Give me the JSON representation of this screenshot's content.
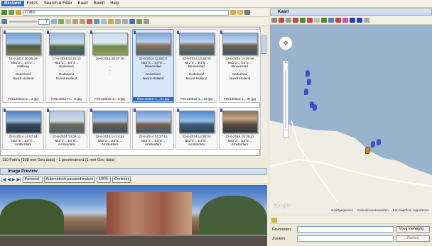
{
  "menu": [
    "Bestand",
    "Foto's",
    "Search & Filter",
    "Kaart",
    "Beeld",
    "Help"
  ],
  "path": "C:\\BD",
  "zoom_spinner": "7",
  "thumbnails": [
    {
      "date": "14-6-2014 20:15:39",
      "coords": "N52°2'...  E4°4'...",
      "city": "Halfweg",
      "country": "Nederland",
      "region": "Noord-Holland",
      "file": "P20140614-2....3.jpg",
      "stars": "☆☆☆☆☆",
      "selected": false,
      "bg": "linear-gradient(#6d9fd8 0%,#a9c8ea 45%,#4d5b3a 60%,#7c7966 100%)"
    },
    {
      "date": "17-6-2014 15:30:43",
      "coords": "N52°2'...  E4°4'...",
      "city": "Ouderkerk",
      "country": "Nederland",
      "region": "Noord-Holland",
      "file": "P20140617-1....5.jpg",
      "stars": "☆☆☆☆☆",
      "selected": false,
      "bg": "linear-gradient(#9bbbe4 0%,#c9dbf0 45%,#5a6a3b 62%,#3b5a78 100%)"
    },
    {
      "date": "18-6-2014 20:07:39",
      "coords": "-",
      "city": "-",
      "country": "-",
      "region": "-",
      "file": "P20140618-2....3.jpg",
      "stars": "",
      "selected": false,
      "bg": "linear-gradient(#c7dcef 0%,#dfe9f3 45%,#6f8a44 62%,#8aa15a 100%)"
    },
    {
      "date": "22-6-2014 11:58:07",
      "coords": "N52°2'...  E4°5'...",
      "city": "Binnenstad",
      "country": "Nederland",
      "region": "Noord-Holland",
      "file": "P20140622-1....31.jpg",
      "stars": "☆☆☆☆☆",
      "selected": true,
      "bg": "linear-gradient(#7aa7de 0%,#b5cde9 40%,#8a6e56 58%,#4c6670 100%)"
    },
    {
      "date": "22-6-2014 13:59:30",
      "coords": "N52°2'...  E4°5'...",
      "city": "Binnenstad",
      "country": "Nederland",
      "region": "Noord-Holland",
      "file": "P20140622-1....33.jpg",
      "stars": "☆☆☆☆☆",
      "selected": false,
      "bg": "linear-gradient(#7ea9df 0%,#bcd2ec 40%,#7b6a58 58%,#425d6c 100%)"
    },
    {
      "date": "22-6-2014 14:00:56",
      "coords": "N52°2'...  E4°5'...",
      "city": "Binnenstad",
      "country": "Nederland",
      "region": "Noord-Holland",
      "file": "P20140622-1....37.jpg",
      "stars": "☆☆☆☆☆",
      "selected": false,
      "bg": "linear-gradient(#84acdf 0%,#c3d6ee 40%,#6e5e4c 58%,#3f5766 100%)"
    },
    {
      "date": "22-6-2014 14:07:54",
      "coords": "N52°2'...  E4°5'...",
      "city": "Amsterdam",
      "country": "",
      "region": "",
      "file": "",
      "stars": "",
      "selected": false,
      "bg": "linear-gradient(#4d7fc0 0%,#9dbce0 45%,#3a4a5a 62%,#253545 100%)"
    },
    {
      "date": "22-6-2014 14:09:11",
      "coords": "N52°2'...  E4°5'...",
      "city": "Amsterdam",
      "country": "",
      "region": "",
      "file": "",
      "stars": "",
      "selected": false,
      "bg": "linear-gradient(#b0c6de 0%,#d0dbe6 45%,#6a6a5a 62%,#55606a 100%)"
    },
    {
      "date": "22-6-2014 14:24:31",
      "coords": "N52°2'...  E4°5'...",
      "city": "Amsterdam",
      "country": "",
      "region": "",
      "file": "",
      "stars": "",
      "selected": false,
      "bg": "linear-gradient(#5f8fcf 0%,#a4c1e2 45%,#6a5a48 62%,#3e5262 100%)"
    },
    {
      "date": "22-6-2014 14:27:13",
      "coords": "N52°2'...  E4°5'...",
      "city": "Amsterdam",
      "country": "",
      "region": "",
      "file": "",
      "stars": "",
      "selected": false,
      "bg": "linear-gradient(#6f9ad6 0%,#b3cbe7 45%,#7d5e4a 62%,#455c6d 100%)"
    },
    {
      "date": "22-6-2014 14:30:03",
      "coords": "N52°2'...  E4°5'...",
      "city": "Amsterdam",
      "country": "",
      "region": "",
      "file": "",
      "stars": "",
      "selected": false,
      "bg": "linear-gradient(#4f86cf 0%,#9bbfe6 45%,#3c5d7a 62%,#2c4358 100%)"
    },
    {
      "date": "22-6-2014 15:35:12",
      "coords": "N52°2'...  E4°5'...",
      "city": "Amsterdam",
      "country": "",
      "region": "",
      "file": "",
      "stars": "",
      "selected": false,
      "bg": "linear-gradient(#8a6e5a 0%,#c8a88a 35%,#5a4c3e 62%,#2f3b44 100%)"
    }
  ],
  "status": "110 Foto's (108 met Geo data) - 1 geselecteerd (1 met Geo data)",
  "preview": {
    "title": "Image Preview",
    "fit_mode": "Passend",
    "auto_fit_button": "Automatisch passend maken",
    "zoom": "100%",
    "center_button": "Centreer"
  },
  "map": {
    "title": "Kaart",
    "footer": [
      "Kaartgegevens",
      "Gebruiksvoorwaarden",
      "Een kaartfout rapporteren"
    ],
    "watermark": "Google"
  },
  "fields": {
    "favorites_label": "Favorieten:",
    "add_button": "Voeg toe/wijzig...",
    "search_label": "Zoeken:",
    "search_button": "Zoeken"
  },
  "colors": {
    "accent": "#316ac5",
    "water": "#99b3cc",
    "land": "#f0ede5",
    "pin": "#3f4fc9"
  }
}
